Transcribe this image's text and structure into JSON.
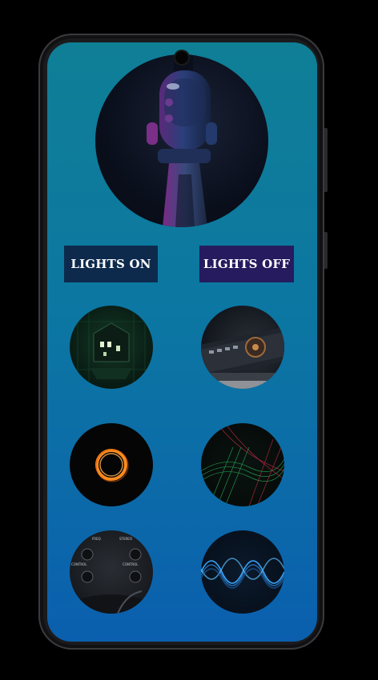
{
  "screen": {
    "buttons": {
      "lights_on": "LIGHTS ON",
      "lights_off": "LIGHTS OFF"
    },
    "hero_image": "microphone-photo",
    "thumbnails": [
      {
        "name": "haunted-house-thumbnail"
      },
      {
        "name": "audio-device-thumbnail"
      },
      {
        "name": "orange-ring-thumbnail"
      },
      {
        "name": "laser-grid-thumbnail"
      },
      {
        "name": "mixer-knobs-thumbnail"
      },
      {
        "name": "sound-wave-thumbnail"
      }
    ]
  },
  "colors": {
    "screen_gradient_top": "#0f7f96",
    "screen_gradient_bottom": "#0b5fae",
    "lights_on_bg": "#0d2a4d",
    "lights_off_bg": "#251b5e",
    "button_text": "#ffffff"
  }
}
